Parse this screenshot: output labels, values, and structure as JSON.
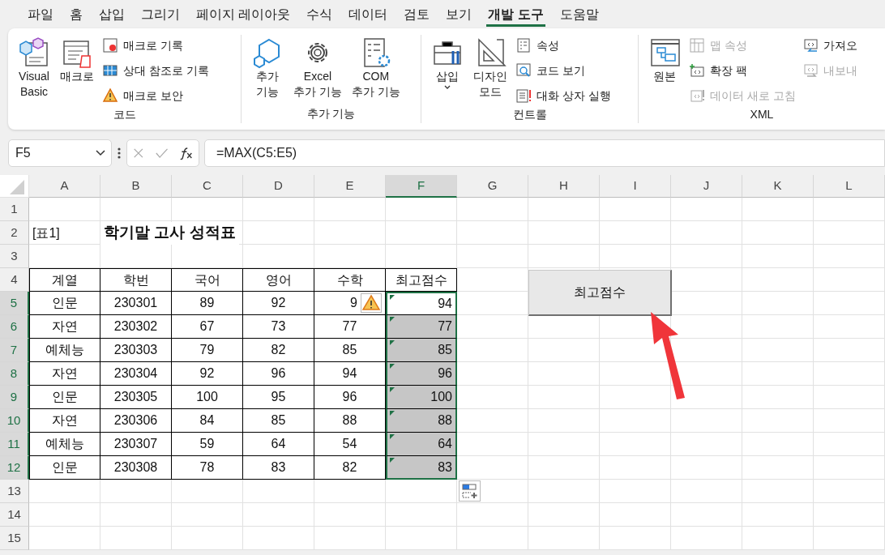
{
  "menu_tabs": [
    {
      "label": "파일",
      "selected": false
    },
    {
      "label": "홈",
      "selected": false
    },
    {
      "label": "삽입",
      "selected": false
    },
    {
      "label": "그리기",
      "selected": false
    },
    {
      "label": "페이지 레이아웃",
      "selected": false
    },
    {
      "label": "수식",
      "selected": false
    },
    {
      "label": "데이터",
      "selected": false
    },
    {
      "label": "검토",
      "selected": false
    },
    {
      "label": "보기",
      "selected": false
    },
    {
      "label": "개발 도구",
      "selected": true
    },
    {
      "label": "도움말",
      "selected": false
    }
  ],
  "ribbon": {
    "groups": [
      {
        "name": "코드",
        "large": [
          {
            "label": "Visual\nBasic"
          },
          {
            "label": "매크로"
          }
        ],
        "small": [
          [
            {
              "label": "매크로 기록",
              "disabled": false
            },
            {
              "label": "상대 참조로 기록",
              "disabled": false
            },
            {
              "label": "매크로 보안",
              "disabled": false
            }
          ]
        ]
      },
      {
        "name": "추가 기능",
        "large": [
          {
            "label": "추가\n기능"
          },
          {
            "label": "Excel\n추가 기능"
          },
          {
            "label": "COM\n추가 기능"
          }
        ]
      },
      {
        "name": "컨트롤",
        "large": [
          {
            "label": "삽입",
            "dropdown": true
          },
          {
            "label": "디자인\n모드"
          }
        ],
        "small": [
          [
            {
              "label": "속성",
              "disabled": false
            },
            {
              "label": "코드 보기",
              "disabled": false
            },
            {
              "label": "대화 상자 실행",
              "disabled": false
            }
          ]
        ]
      },
      {
        "name": "XML",
        "large": [
          {
            "label": "원본"
          }
        ],
        "small": [
          [
            {
              "label": "맵 속성",
              "disabled": true
            },
            {
              "label": "확장 팩",
              "disabled": false
            },
            {
              "label": "데이터 새로 고침",
              "disabled": true
            }
          ],
          [
            {
              "label": "가져오",
              "disabled": false
            },
            {
              "label": "내보내",
              "disabled": true
            }
          ]
        ]
      }
    ]
  },
  "name_box": {
    "value": "F5"
  },
  "formula_bar": {
    "value": "=MAX(C5:E5)"
  },
  "sheet": {
    "columns": [
      {
        "letter": "A",
        "selected": false
      },
      {
        "letter": "B",
        "selected": false
      },
      {
        "letter": "C",
        "selected": false
      },
      {
        "letter": "D",
        "selected": false
      },
      {
        "letter": "E",
        "selected": false
      },
      {
        "letter": "F",
        "selected": true
      },
      {
        "letter": "G",
        "selected": false
      },
      {
        "letter": "H",
        "selected": false
      },
      {
        "letter": "I",
        "selected": false
      },
      {
        "letter": "J",
        "selected": false
      },
      {
        "letter": "K",
        "selected": false
      },
      {
        "letter": "L",
        "selected": false
      }
    ],
    "rows": [
      {
        "number": "1",
        "selected": false,
        "cells": []
      },
      {
        "number": "2",
        "selected": false,
        "cells": [
          {
            "text": "[표1]",
            "kind": "note"
          },
          {
            "text": "학기말 고사 성적표",
            "kind": "title"
          }
        ]
      },
      {
        "number": "3",
        "selected": false,
        "cells": []
      },
      {
        "number": "4",
        "selected": false,
        "cells": [
          {
            "text": "계열",
            "kind": "header"
          },
          {
            "text": "학번",
            "kind": "header"
          },
          {
            "text": "국어",
            "kind": "header"
          },
          {
            "text": "영어",
            "kind": "header"
          },
          {
            "text": "수학",
            "kind": "header"
          },
          {
            "text": "최고점수",
            "kind": "header"
          }
        ]
      },
      {
        "number": "5",
        "selected": true,
        "cells": [
          {
            "text": "인문",
            "kind": "entry"
          },
          {
            "text": "230301",
            "kind": "entry"
          },
          {
            "text": "89",
            "kind": "entry"
          },
          {
            "text": "92",
            "kind": "entry"
          },
          {
            "text": "9",
            "kind": "entry",
            "warning": true
          },
          {
            "text": "94",
            "kind": "formula",
            "selected": true,
            "active": true
          }
        ]
      },
      {
        "number": "6",
        "selected": true,
        "cells": [
          {
            "text": "자연",
            "kind": "entry"
          },
          {
            "text": "230302",
            "kind": "entry"
          },
          {
            "text": "67",
            "kind": "entry"
          },
          {
            "text": "73",
            "kind": "entry"
          },
          {
            "text": "77",
            "kind": "entry"
          },
          {
            "text": "77",
            "kind": "formula",
            "selected": true,
            "active": false
          }
        ]
      },
      {
        "number": "7",
        "selected": true,
        "cells": [
          {
            "text": "예체능",
            "kind": "entry"
          },
          {
            "text": "230303",
            "kind": "entry"
          },
          {
            "text": "79",
            "kind": "entry"
          },
          {
            "text": "82",
            "kind": "entry"
          },
          {
            "text": "85",
            "kind": "entry"
          },
          {
            "text": "85",
            "kind": "formula",
            "selected": true,
            "active": false
          }
        ]
      },
      {
        "number": "8",
        "selected": true,
        "cells": [
          {
            "text": "자연",
            "kind": "entry"
          },
          {
            "text": "230304",
            "kind": "entry"
          },
          {
            "text": "92",
            "kind": "entry"
          },
          {
            "text": "96",
            "kind": "entry"
          },
          {
            "text": "94",
            "kind": "entry"
          },
          {
            "text": "96",
            "kind": "formula",
            "selected": true,
            "active": false
          }
        ]
      },
      {
        "number": "9",
        "selected": true,
        "cells": [
          {
            "text": "인문",
            "kind": "entry"
          },
          {
            "text": "230305",
            "kind": "entry"
          },
          {
            "text": "100",
            "kind": "entry"
          },
          {
            "text": "95",
            "kind": "entry"
          },
          {
            "text": "96",
            "kind": "entry"
          },
          {
            "text": "100",
            "kind": "formula",
            "selected": true,
            "active": false
          }
        ]
      },
      {
        "number": "10",
        "selected": true,
        "cells": [
          {
            "text": "자연",
            "kind": "entry"
          },
          {
            "text": "230306",
            "kind": "entry"
          },
          {
            "text": "84",
            "kind": "entry"
          },
          {
            "text": "85",
            "kind": "entry"
          },
          {
            "text": "88",
            "kind": "entry"
          },
          {
            "text": "88",
            "kind": "formula",
            "selected": true,
            "active": false
          }
        ]
      },
      {
        "number": "11",
        "selected": true,
        "cells": [
          {
            "text": "예체능",
            "kind": "entry"
          },
          {
            "text": "230307",
            "kind": "entry"
          },
          {
            "text": "59",
            "kind": "entry"
          },
          {
            "text": "64",
            "kind": "entry"
          },
          {
            "text": "54",
            "kind": "entry"
          },
          {
            "text": "64",
            "kind": "formula",
            "selected": true,
            "active": false
          }
        ]
      },
      {
        "number": "12",
        "selected": true,
        "cells": [
          {
            "text": "인문",
            "kind": "entry"
          },
          {
            "text": "230308",
            "kind": "entry"
          },
          {
            "text": "78",
            "kind": "entry"
          },
          {
            "text": "83",
            "kind": "entry"
          },
          {
            "text": "82",
            "kind": "entry"
          },
          {
            "text": "83",
            "kind": "formula",
            "selected": true,
            "active": false
          }
        ]
      },
      {
        "number": "13",
        "selected": false,
        "cells": []
      },
      {
        "number": "14",
        "selected": false,
        "cells": []
      },
      {
        "number": "15",
        "selected": false,
        "cells": []
      }
    ]
  },
  "macro_button": {
    "label": "최고점수"
  }
}
